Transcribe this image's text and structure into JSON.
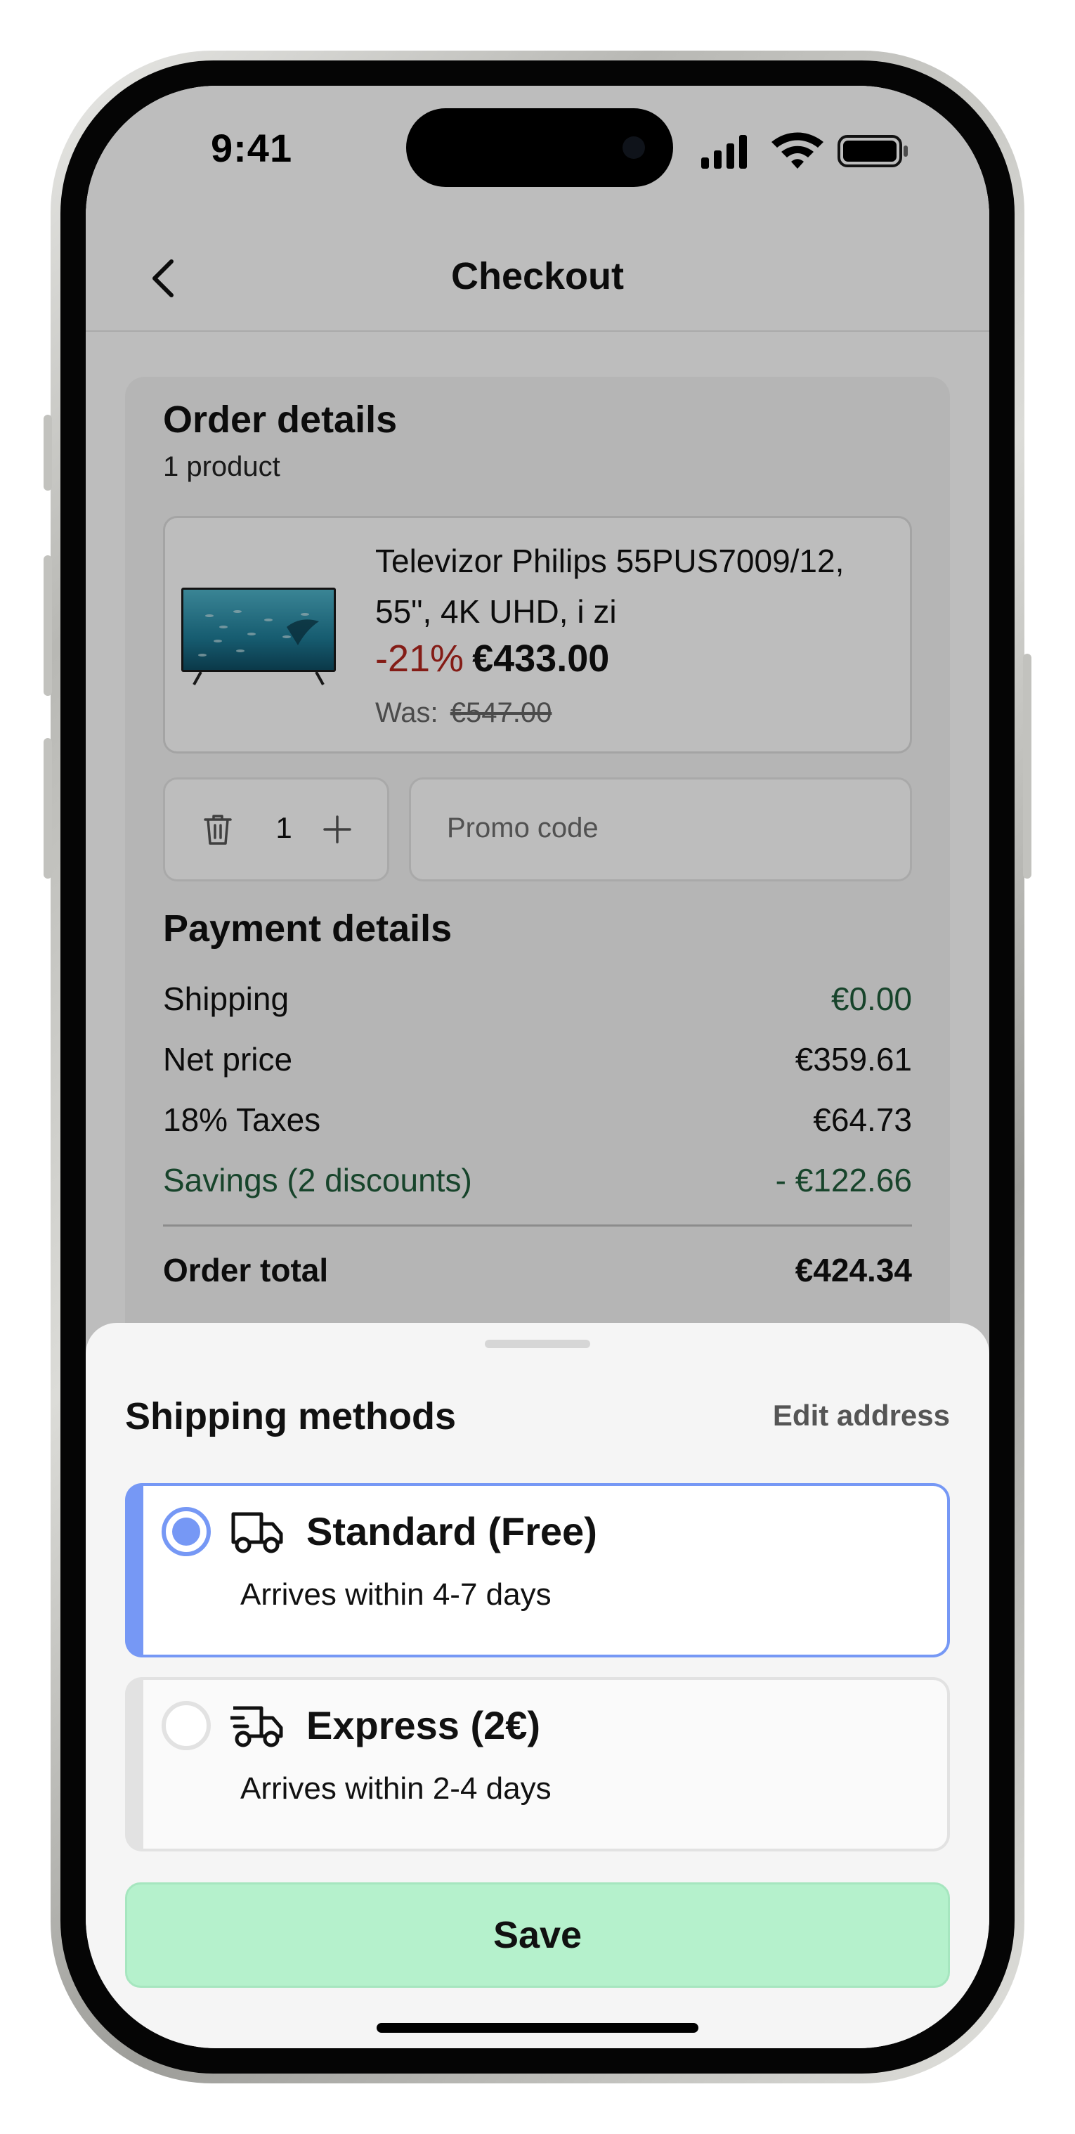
{
  "status_bar": {
    "time": "9:41"
  },
  "nav": {
    "title": "Checkout"
  },
  "order": {
    "heading": "Order details",
    "count": "1 product",
    "product": {
      "name": "Televizor Philips 55PUS7009/12, 55\", 4K UHD, i zi",
      "discount": "-21%",
      "price": "€433.00",
      "was_label": "Was:",
      "was_price": "€547.00"
    },
    "quantity": "1",
    "promo_placeholder": "Promo code"
  },
  "payment": {
    "heading": "Payment details",
    "rows": [
      {
        "label": "Shipping",
        "value": "€0.00"
      },
      {
        "label": "Net price",
        "value": "€359.61"
      },
      {
        "label": "18% Taxes",
        "value": "€64.73"
      },
      {
        "label": "Savings (2 discounts)",
        "value": "- €122.66"
      }
    ],
    "total_label": "Order total",
    "total_value": "€424.34"
  },
  "sheet": {
    "title": "Shipping methods",
    "edit_link": "Edit address",
    "methods": [
      {
        "title": "Standard (Free)",
        "desc": "Arrives within 4-7 days",
        "selected": true,
        "icon": "truck-icon"
      },
      {
        "title": "Express (2€)",
        "desc": "Arrives within 2-4 days",
        "selected": false,
        "icon": "fast-truck-icon"
      }
    ],
    "save_label": "Save"
  },
  "colors": {
    "accent_blue": "#7698f5",
    "save_green": "#b5f1cc",
    "discount_red": "#b3261e",
    "savings_green": "#1f5c3a"
  }
}
